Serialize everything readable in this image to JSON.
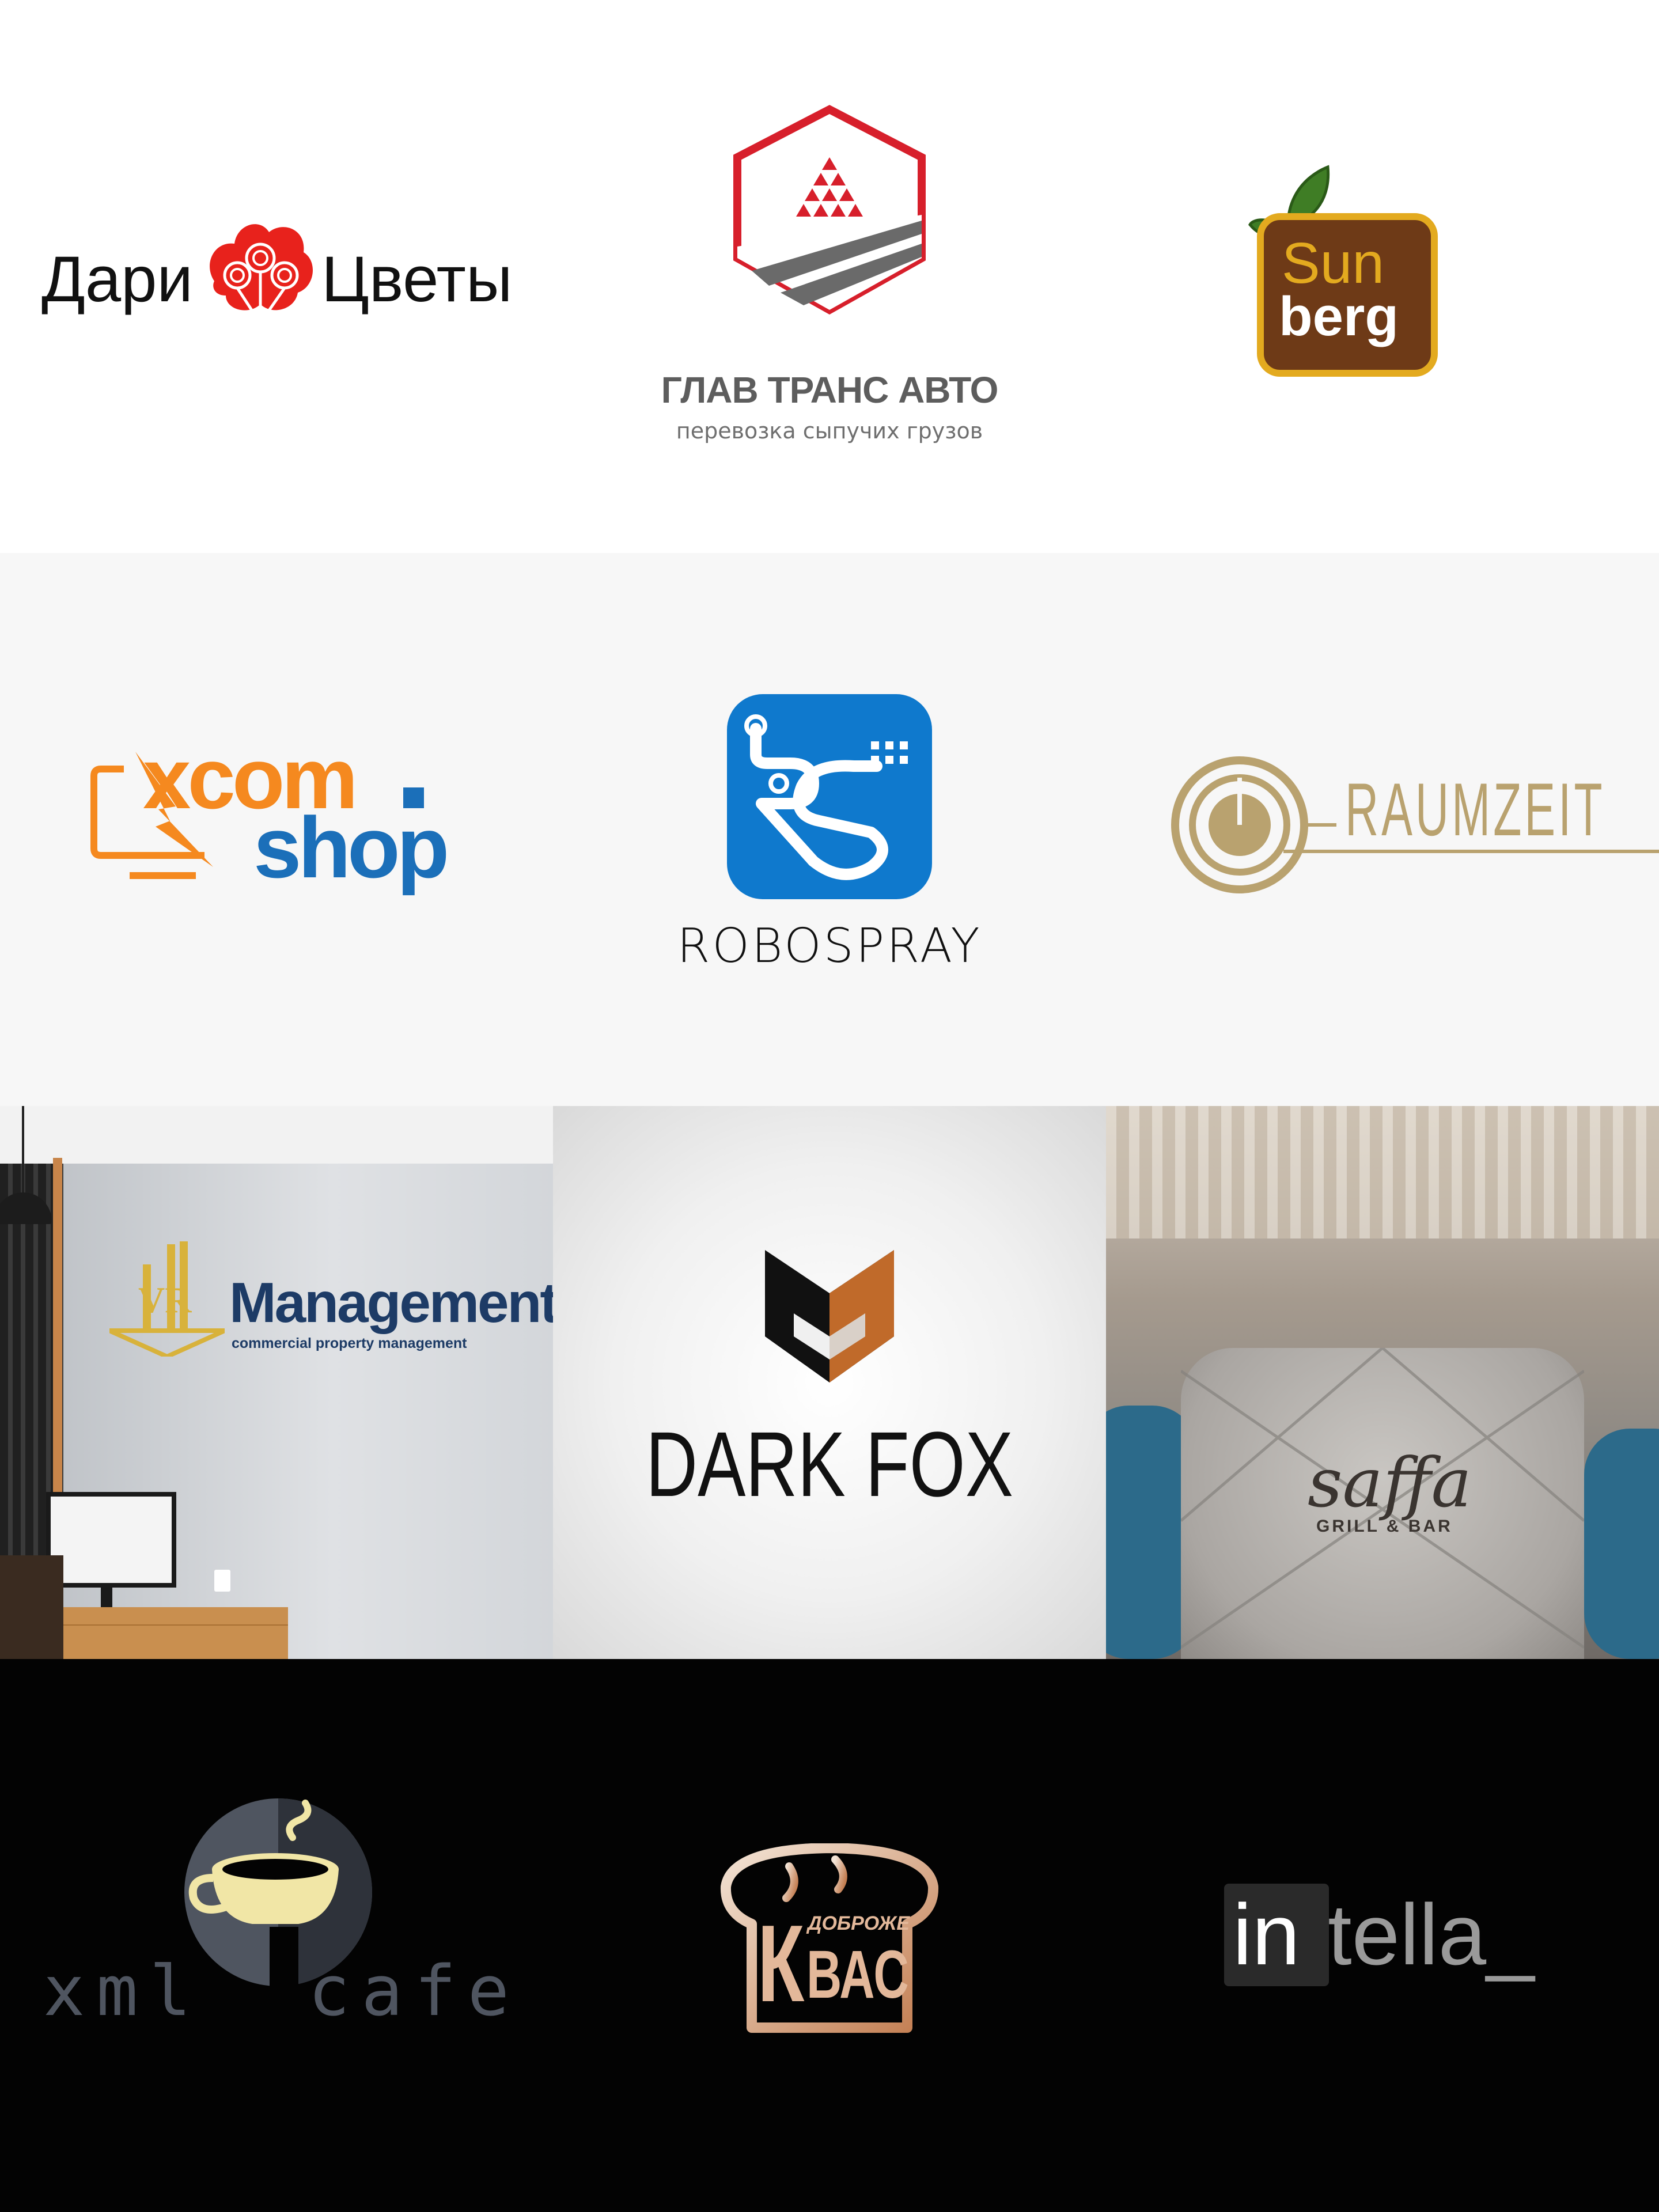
{
  "colors": {
    "row1_bg": "#ffffff",
    "row2_bg": "#f7f7f7",
    "row4_bg": "#030303",
    "dari_red": "#e8221c",
    "glav_red": "#d71f2b",
    "glav_gray": "#5d5d5d",
    "sunberg_brown": "#6e3a17",
    "sunberg_gold": "#e3aa1f",
    "sunberg_green": "#3f7d25",
    "xcom_orange": "#f5891f",
    "xcom_blue": "#1b6fb9",
    "robospray_blue": "#0f79cd",
    "raumzeit_gold": "#b9a26f",
    "vr_navy": "#1d3b66",
    "vr_gold": "#d8b23b",
    "darkfox_orange": "#c06a2a",
    "saffa_text": "#3a3430",
    "xml_gray": "#4f5560",
    "cup_yellow": "#f1e6a6",
    "kvas_copper": "#d59e7c",
    "intella_gray": "#9a9a9a"
  },
  "logos": {
    "dari": {
      "left": "Дари",
      "right": "Цветы",
      "icon": "lollipop-flower-icon"
    },
    "glav": {
      "title": "ГЛАВ ТРАНС АВТО",
      "subtitle": "перевозка сыпучих грузов",
      "icon": "hexagon-road-icon"
    },
    "sunberg": {
      "top": "Sun",
      "bottom": "berg",
      "icon": "leaf-icon"
    },
    "xcom": {
      "top": "xcom",
      "bottom": "shop",
      "icon": "monitor-bolt-icon"
    },
    "robospray": {
      "name": "ROBOSPRAY",
      "icon": "rs-robot-icon"
    },
    "raumzeit": {
      "name": "RAUMZEIT",
      "icon": "clock-circle-icon"
    },
    "vr": {
      "mark": "VR",
      "name": "Management",
      "tagline": "commercial property management"
    },
    "darkfox": {
      "name": "DARK FOX",
      "icon": "fox-head-icon"
    },
    "saffa": {
      "name": "saffa",
      "tagline": "GRILL & BAR"
    },
    "xmlcafe": {
      "left": "xml",
      "right": "cafe",
      "icon": "coffee-cup-icon"
    },
    "kvas": {
      "small": "ДОБРОЖЕ",
      "big_left": "К",
      "big_right": "ВАС",
      "icon": "bread-loaf-icon"
    },
    "intella": {
      "highlight": "in",
      "rest": "tella_"
    }
  }
}
